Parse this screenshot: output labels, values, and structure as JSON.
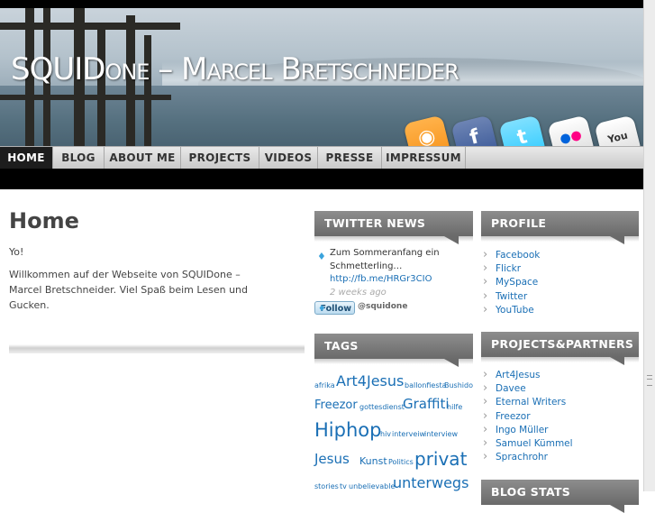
{
  "site": {
    "title_first": "SQUID",
    "title_rest": "one – Marcel Bretschneider"
  },
  "social_icons": [
    {
      "name": "rss",
      "glyph": "◉",
      "color": "#f7941d"
    },
    {
      "name": "facebook",
      "glyph": "f",
      "color": "#3b5998"
    },
    {
      "name": "twitter",
      "glyph": "t",
      "color": "#33ccff"
    },
    {
      "name": "flickr",
      "glyph": "●",
      "color": "#ffffff"
    },
    {
      "name": "youtube",
      "glyph": "You",
      "color": "#ffffff"
    }
  ],
  "nav": {
    "items": [
      "HOME",
      "BLOG",
      "ABOUT ME",
      "PROJECTS",
      "VIDEOS",
      "PRESSE",
      "IMPRESSUM"
    ],
    "active": "HOME"
  },
  "main": {
    "heading": "Home",
    "para1": "Yo!",
    "para2": "Willkommen auf der Webseite von SQUIDone – Marcel Bretschneider. Viel Spaß beim Lesen und Gucken."
  },
  "twitter": {
    "title": "TWITTER NEWS",
    "tweet_line1": "Zum Sommeranfang ein",
    "tweet_line2": "Schmetterling…",
    "tweet_link": "http://fb.me/HRGr3CIO",
    "tweet_time": "2 weeks ago",
    "follow_label": "Follow",
    "follow_handle": "@squidone"
  },
  "tags_widget": {
    "title": "TAGS",
    "tags": [
      {
        "label": "afrika",
        "size": 8
      },
      {
        "label": "Art4Jesus",
        "size": 16
      },
      {
        "label": "ballonfiesta",
        "size": 8
      },
      {
        "label": "Bushido",
        "size": 8
      },
      {
        "label": "Freezor",
        "size": 13
      },
      {
        "label": "gottesdienst",
        "size": 8
      },
      {
        "label": "Graffiti",
        "size": 15
      },
      {
        "label": "hilfe",
        "size": 8
      },
      {
        "label": "Hiphop",
        "size": 21
      },
      {
        "label": "hiv",
        "size": 8
      },
      {
        "label": "interveiw",
        "size": 8
      },
      {
        "label": "interview",
        "size": 8
      },
      {
        "label": "Jesus",
        "size": 15
      },
      {
        "label": "Kunst",
        "size": 11
      },
      {
        "label": "Politics",
        "size": 8
      },
      {
        "label": "privat",
        "size": 20
      },
      {
        "label": "stories",
        "size": 8
      },
      {
        "label": "tv",
        "size": 8
      },
      {
        "label": "unbelievable",
        "size": 8
      },
      {
        "label": "unterwegs",
        "size": 16
      }
    ]
  },
  "profile": {
    "title": "PROFILE",
    "links": [
      "Facebook",
      "Flickr",
      "MySpace",
      "Twitter",
      "YouTube"
    ]
  },
  "partners": {
    "title": "PROJECTS&PARTNERS",
    "links": [
      "Art4Jesus",
      "Davee",
      "Eternal Writers",
      "Freezor",
      "Ingo Müller",
      "Samuel Kümmel",
      "Sprachrohr"
    ]
  },
  "blogstats": {
    "title": "BLOG STATS"
  }
}
